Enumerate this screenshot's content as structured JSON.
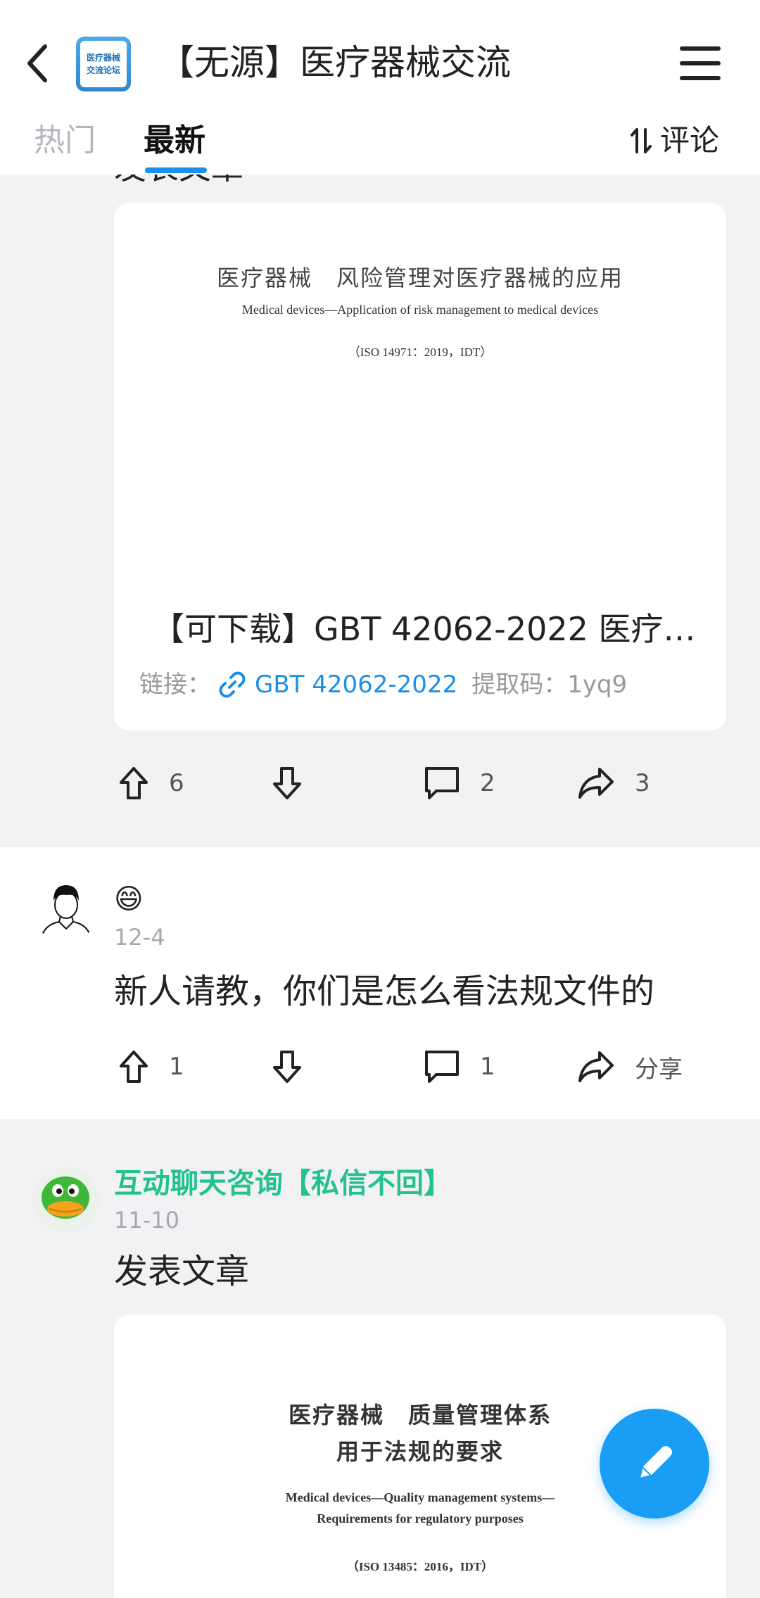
{
  "header": {
    "forum_title": "【无源】医疗器械交流",
    "logo_line1": "医疗器械",
    "logo_line2": "交流论坛"
  },
  "tabs": {
    "hot": "热门",
    "newest": "最新",
    "sort_label": "评论"
  },
  "post1": {
    "partial_text": "发表文章",
    "doc": {
      "title_cn": "医疗器械　风险管理对医疗器械的应用",
      "title_en": "Medical devices—Application of risk management to medical devices",
      "iso": "（ISO 14971：2019，IDT）"
    },
    "card_title": "【可下载】GBT 42062-2022 医疗…",
    "link_label": "链接：",
    "link_text": "GBT 42062-2022",
    "code_label": "提取码：1yq9",
    "upvotes": "6",
    "comments": "2",
    "shares": "3"
  },
  "post2": {
    "name_emoji": "😄",
    "date": "12-4",
    "text": "新人请教，你们是怎么看法规文件的",
    "upvotes": "1",
    "comments": "1",
    "share_label": "分享"
  },
  "post3": {
    "name": "互动聊天咨询【私信不回】",
    "date": "11-10",
    "text": "发表文章",
    "doc": {
      "title_cn_1": "医疗器械　质量管理体系",
      "title_cn_2": "用于法规的要求",
      "title_en_1": "Medical devices—Quality management systems—",
      "title_en_2": "Requirements for regulatory purposes",
      "iso": "（ISO 13485：2016，IDT）"
    }
  },
  "colors": {
    "accent": "#1890f0",
    "link": "#1a8fe6",
    "username_green": "#22c28e",
    "fab": "#1a9df5"
  }
}
